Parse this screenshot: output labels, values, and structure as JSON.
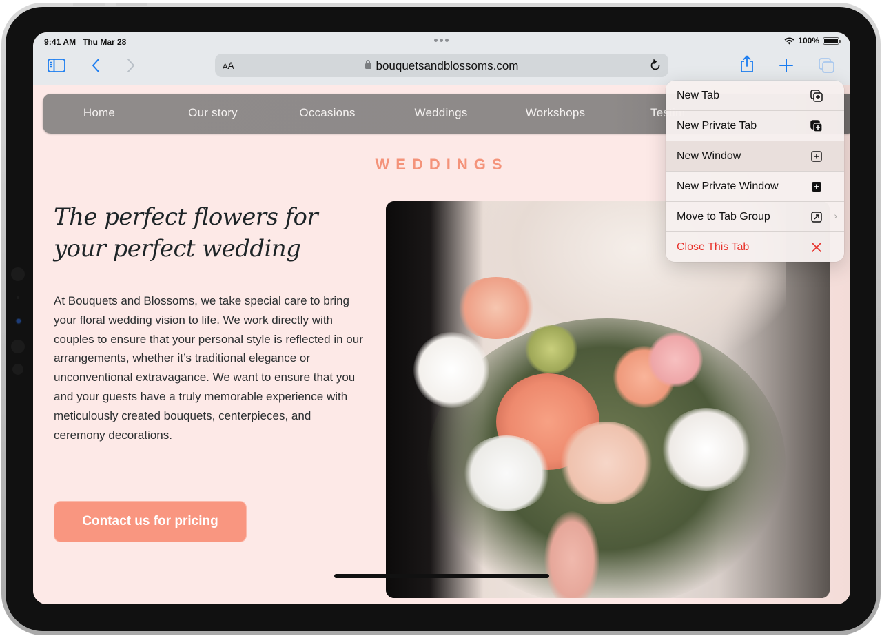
{
  "status_bar": {
    "time": "9:41 AM",
    "date": "Thu Mar 28",
    "battery": "100%",
    "battery_level": 1.0
  },
  "toolbar": {
    "sidebar_icon": "sidebar-icon",
    "back_icon": "chevron-left-icon",
    "forward_icon": "chevron-right-icon",
    "text_size_label": "AA",
    "url": "bouquetsandblossoms.com",
    "share_icon": "share-icon",
    "new_tab_icon": "plus-icon",
    "tabs_icon": "tabs-overview-icon"
  },
  "site": {
    "nav": [
      "Home",
      "Our story",
      "Occasions",
      "Weddings",
      "Workshops",
      "Testim"
    ],
    "eyebrow": "WEDDINGS",
    "headline_line1": "The perfect flowers for",
    "headline_line2": "your perfect wedding",
    "body": "At Bouquets and Blossoms, we take special care to bring your floral wedding vision to life. We work directly with couples to ensure that your personal style is reflected in our arrangements, whether it’s traditional elegance or unconventional extravagance. We want to ensure that you and your guests have a truly memorable experience with meticulously created bouquets, centerpieces, and ceremony decorations.",
    "cta_label": "Contact us for pricing",
    "hero_image_alt": "Bride holding a bouquet of peach and white roses"
  },
  "menu": {
    "items": [
      {
        "label": "New Tab",
        "icon": "new-tab-icon"
      },
      {
        "label": "New Private Tab",
        "icon": "new-private-tab-icon"
      },
      {
        "label": "New Window",
        "icon": "new-window-icon"
      },
      {
        "label": "New Private Window",
        "icon": "new-private-window-icon"
      },
      {
        "label": "Move to Tab Group",
        "icon": "move-to-tab-group-icon",
        "has_submenu": true
      },
      {
        "label": "Close This Tab",
        "icon": "close-icon",
        "destructive": true
      }
    ]
  },
  "colors": {
    "accent_blue": "#1a7cf0",
    "brand_coral": "#f99680",
    "eyebrow_coral": "#f4937a",
    "destructive_red": "#e8322b",
    "page_background": "#fde9e7",
    "nav_background": "#8f8b8a"
  }
}
